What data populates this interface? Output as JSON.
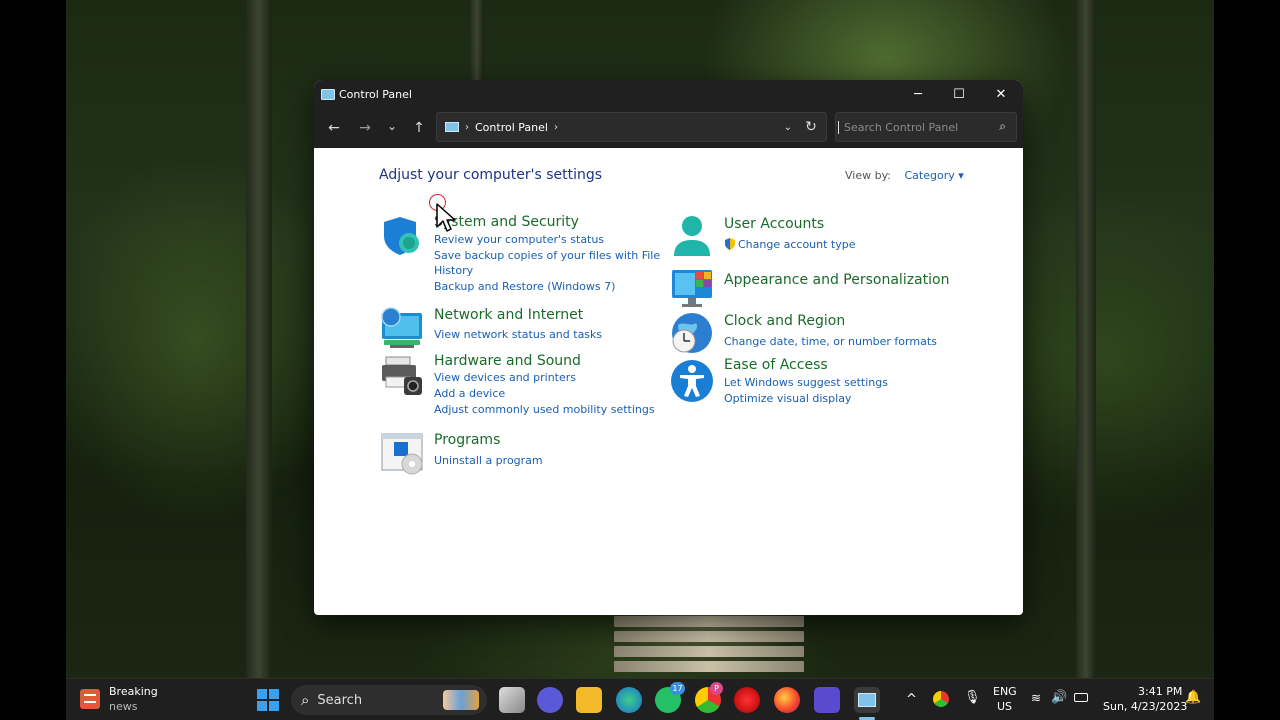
{
  "window": {
    "title": "Control Panel",
    "minimize": "─",
    "maximize": "☐",
    "close": "✕"
  },
  "navbar": {
    "back": "←",
    "forward": "→",
    "recent": "⌄",
    "up": "↑",
    "breadcrumb": "Control Panel",
    "refresh": "↻",
    "search_placeholder": "Search Control Panel"
  },
  "main": {
    "heading": "Adjust your computer's settings",
    "view_by_label": "View by:",
    "view_by_value": "Category ▾"
  },
  "categories": {
    "system_security": {
      "title": "System and Security",
      "links": [
        "Review your computer's status",
        "Save backup copies of your files with File",
        "History",
        "Backup and Restore (Windows 7)"
      ]
    },
    "network": {
      "title": "Network and Internet",
      "links": [
        "View network status and tasks"
      ]
    },
    "hardware": {
      "title": "Hardware and Sound",
      "links": [
        "View devices and printers",
        "Add a device",
        "Adjust commonly used mobility settings"
      ]
    },
    "programs": {
      "title": "Programs",
      "links": [
        "Uninstall a program"
      ]
    },
    "user_accounts": {
      "title": "User Accounts",
      "links": [
        "Change account type"
      ]
    },
    "appearance": {
      "title": "Appearance and Personalization"
    },
    "clock": {
      "title": "Clock and Region",
      "links": [
        "Change date, time, or number formats"
      ]
    },
    "ease": {
      "title": "Ease of Access",
      "links": [
        "Let Windows suggest settings",
        "Optimize visual display"
      ]
    }
  },
  "taskbar": {
    "widget_title": "Breaking",
    "widget_subtitle": "news",
    "search_label": "Search",
    "whatsapp_badge": "17",
    "chrome_badge": "P",
    "language": "ENG",
    "region": "US",
    "time": "3:41 PM",
    "date": "Sun, 4/23/2023",
    "tray_up": "^"
  }
}
